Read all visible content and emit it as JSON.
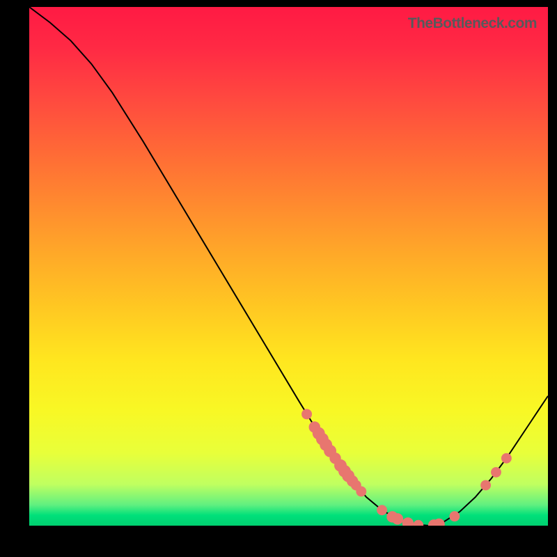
{
  "attribution": "TheBottleneck.com",
  "chart_data": {
    "type": "line",
    "title": "",
    "xlabel": "",
    "ylabel": "",
    "xlim": [
      0,
      100
    ],
    "ylim": [
      0,
      100
    ],
    "curve": [
      {
        "x": 0,
        "y": 100
      },
      {
        "x": 4,
        "y": 97
      },
      {
        "x": 8,
        "y": 93.5
      },
      {
        "x": 12,
        "y": 89
      },
      {
        "x": 16,
        "y": 83.5
      },
      {
        "x": 22,
        "y": 74
      },
      {
        "x": 28,
        "y": 64
      },
      {
        "x": 34,
        "y": 54
      },
      {
        "x": 40,
        "y": 44
      },
      {
        "x": 46,
        "y": 34
      },
      {
        "x": 52,
        "y": 24
      },
      {
        "x": 56,
        "y": 17.5
      },
      {
        "x": 59,
        "y": 13
      },
      {
        "x": 62,
        "y": 9
      },
      {
        "x": 65,
        "y": 5.5
      },
      {
        "x": 68,
        "y": 3
      },
      {
        "x": 71,
        "y": 1.3
      },
      {
        "x": 74,
        "y": 0.3
      },
      {
        "x": 77,
        "y": 0
      },
      {
        "x": 80,
        "y": 0.8
      },
      {
        "x": 83,
        "y": 2.7
      },
      {
        "x": 86,
        "y": 5.5
      },
      {
        "x": 89,
        "y": 9
      },
      {
        "x": 92,
        "y": 13
      },
      {
        "x": 95,
        "y": 17.5
      },
      {
        "x": 98,
        "y": 22
      },
      {
        "x": 100,
        "y": 25
      }
    ],
    "markers": [
      {
        "x": 53.5,
        "y": 21.5,
        "r": 1.0
      },
      {
        "x": 55,
        "y": 19,
        "r": 1.1
      },
      {
        "x": 55.8,
        "y": 17.8,
        "r": 1.2
      },
      {
        "x": 56.5,
        "y": 16.7,
        "r": 1.2
      },
      {
        "x": 57.2,
        "y": 15.6,
        "r": 1.2
      },
      {
        "x": 58,
        "y": 14.4,
        "r": 1.2
      },
      {
        "x": 59,
        "y": 13,
        "r": 1.1
      },
      {
        "x": 60,
        "y": 11.6,
        "r": 1.2
      },
      {
        "x": 60.8,
        "y": 10.5,
        "r": 1.2
      },
      {
        "x": 61.5,
        "y": 9.6,
        "r": 1.2
      },
      {
        "x": 62.3,
        "y": 8.6,
        "r": 1.1
      },
      {
        "x": 63,
        "y": 7.8,
        "r": 1.0
      },
      {
        "x": 64,
        "y": 6.6,
        "r": 1.0
      },
      {
        "x": 68,
        "y": 3,
        "r": 1.0
      },
      {
        "x": 70,
        "y": 1.7,
        "r": 1.1
      },
      {
        "x": 71,
        "y": 1.3,
        "r": 1.1
      },
      {
        "x": 73,
        "y": 0.5,
        "r": 1.1
      },
      {
        "x": 75,
        "y": 0.1,
        "r": 1.0
      },
      {
        "x": 78,
        "y": 0.1,
        "r": 1.1
      },
      {
        "x": 79,
        "y": 0.3,
        "r": 1.1
      },
      {
        "x": 82,
        "y": 1.8,
        "r": 1.0
      },
      {
        "x": 88,
        "y": 7.8,
        "r": 1.0
      },
      {
        "x": 90,
        "y": 10.3,
        "r": 1.0
      },
      {
        "x": 92,
        "y": 13,
        "r": 1.0
      }
    ],
    "marker_color": "#e8766f",
    "curve_color": "#000000"
  }
}
